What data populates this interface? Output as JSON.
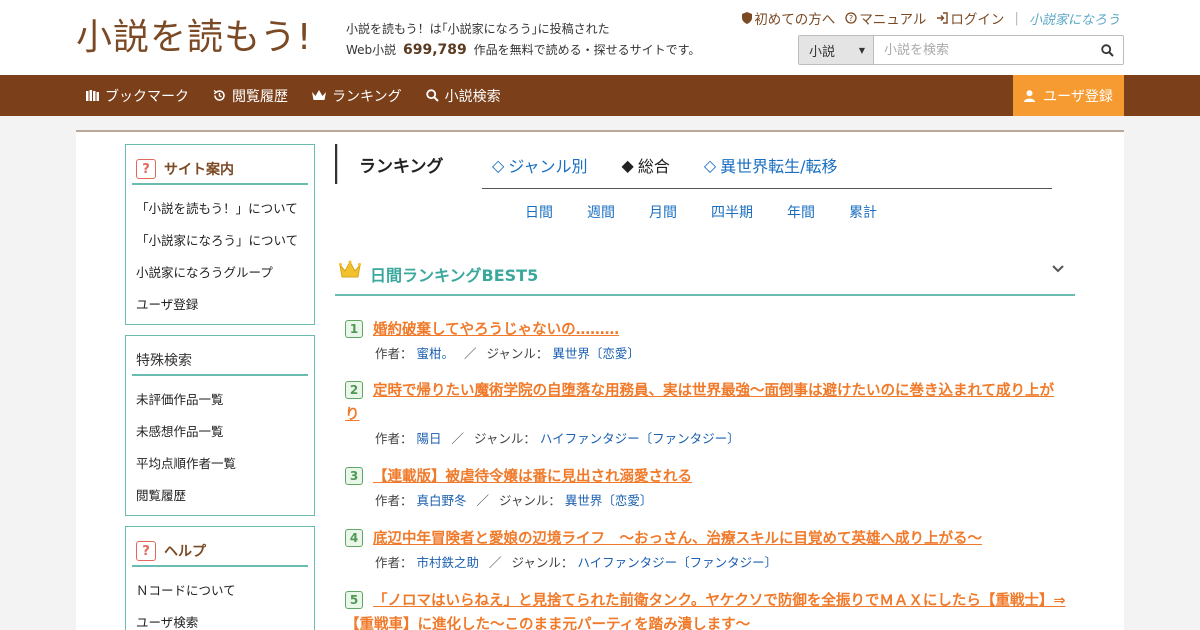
{
  "header": {
    "logo": "小説を読もう!",
    "tagline_line1": "小説を読もう！は｢小説家になろう｣に投稿された",
    "tagline_prefix": "Web小説",
    "tagline_count": "699,789",
    "tagline_suffix": "作品を無料で読める・探せるサイトです。",
    "links": {
      "first_time": "初めての方へ",
      "manual": "マニュアル",
      "login": "ログイン",
      "narou": "小説家になろう"
    },
    "search": {
      "select_value": "小説",
      "placeholder": "小説を検索"
    }
  },
  "nav": {
    "bookmark": "ブックマーク",
    "history": "閲覧履歴",
    "ranking": "ランキング",
    "search": "小説検索",
    "register": "ユーザ登録"
  },
  "sidebar": {
    "site_guide": {
      "title": "サイト案内",
      "items": [
        "「小説を読もう！」について",
        "「小説家になろう」について",
        "小説家になろうグループ",
        "ユーザ登録"
      ]
    },
    "special_search": {
      "title": "特殊検索",
      "items": [
        "未評価作品一覧",
        "未感想作品一覧",
        "平均点順作者一覧",
        "閲覧履歴"
      ]
    },
    "help": {
      "title": "ヘルプ",
      "items": [
        "Ｎコードについて",
        "ユーザ検索"
      ]
    }
  },
  "ranking": {
    "title": "ランキング",
    "tabs": [
      "ジャンル別",
      "総合",
      "異世界転生/転移"
    ],
    "tab_markers": [
      "◇",
      "◆",
      "◇"
    ],
    "periods": [
      "日間",
      "週間",
      "月間",
      "四半期",
      "年間",
      "累計"
    ],
    "best_title": "日間ランキングBEST5",
    "labels": {
      "author": "作者：",
      "genre": "ジャンル："
    },
    "items": [
      {
        "num": "1",
        "title": "婚約破棄してやろうじゃないの………",
        "author": "蜜柑。",
        "genre": "異世界〔恋愛〕"
      },
      {
        "num": "2",
        "title": "定時で帰りたい魔術学院の自堕落な用務員、実は世界最強～面倒事は避けたいのに巻き込まれて成り上がり",
        "author": "陽日",
        "genre": "ハイファンタジー〔ファンタジー〕"
      },
      {
        "num": "3",
        "title": "【連載版】被虐待令嬢は番に見出され溺愛される",
        "author": "真白野冬",
        "genre": "異世界〔恋愛〕"
      },
      {
        "num": "4",
        "title": "底辺中年冒険者と愛娘の辺境ライフ　〜おっさん、治療スキルに目覚めて英雄へ成り上がる〜",
        "author": "市村鉄之助",
        "genre": "ハイファンタジー〔ファンタジー〕"
      },
      {
        "num": "5",
        "title": "「ノロマはいらねえ」と見捨てられた前衛タンク。ヤケクソで防御を全振りでＭＡＸにしたら【重戦士】⇒【重戦車】に進化した～このまま元パーティを踏み潰します～",
        "author": "",
        "genre": ""
      }
    ]
  }
}
